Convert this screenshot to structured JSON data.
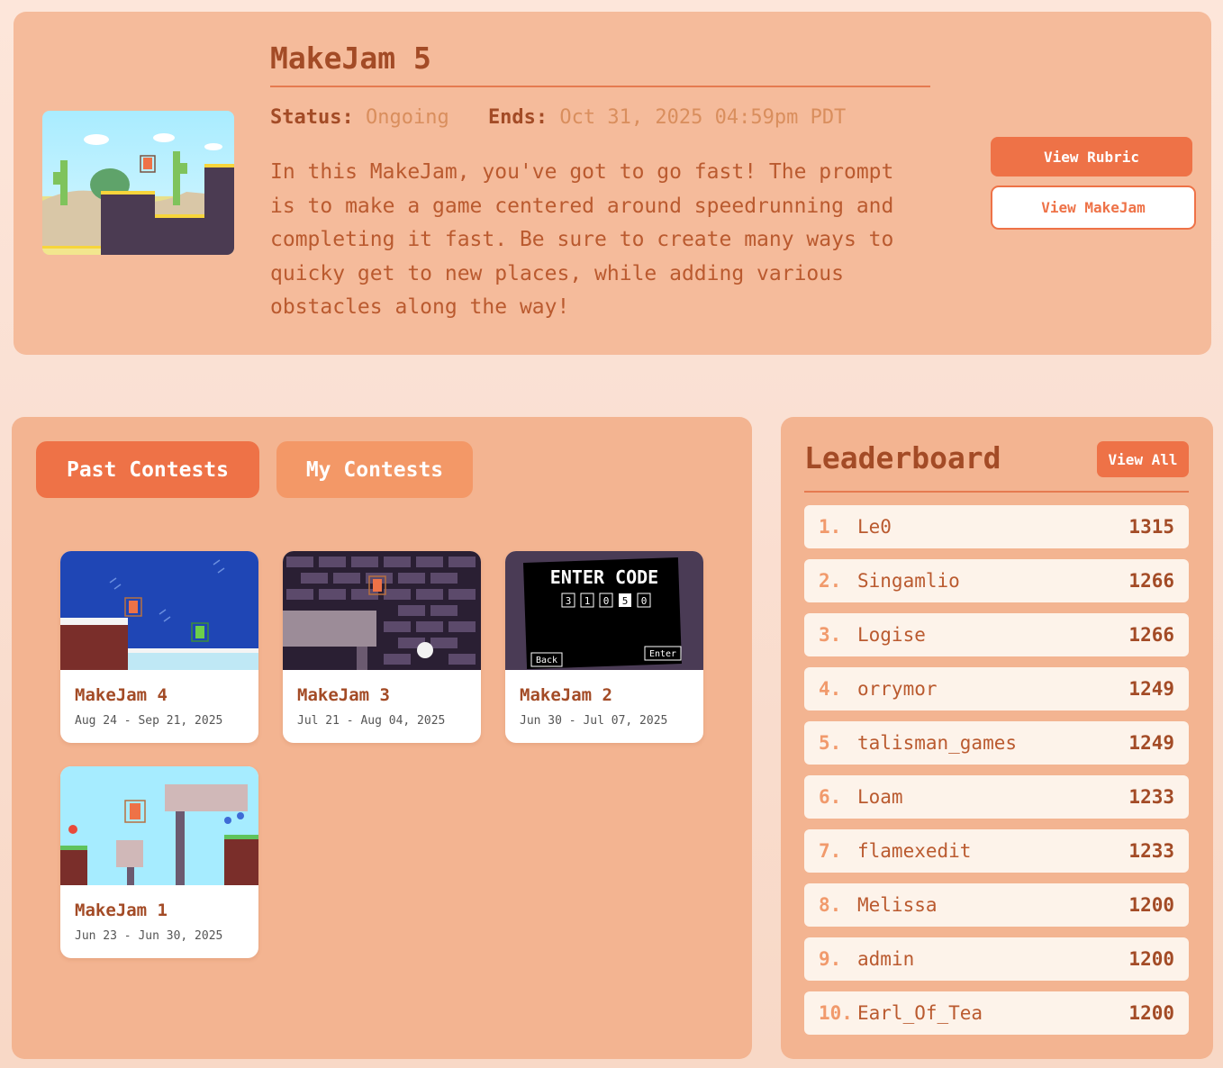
{
  "current": {
    "title": "MakeJam 5",
    "status_label": "Status:",
    "status_value": "Ongoing",
    "ends_label": "Ends:",
    "ends_value": "Oct 31, 2025 04:59pm PDT",
    "description": "In this MakeJam, you've got to go fast! The prompt is to make a game centered around speedrunning and completing it fast. Be sure to create many ways to quicky get to new places, while adding various obstacles along the way!",
    "view_rubric": "View Rubric",
    "view_makejam": "View MakeJam"
  },
  "tabs": {
    "past": "Past Contests",
    "mine": "My Contests"
  },
  "past_contests": [
    {
      "title": "MakeJam 4",
      "dates": "Aug 24 - Sep 21, 2025"
    },
    {
      "title": "MakeJam 3",
      "dates": "Jul 21 - Aug 04, 2025"
    },
    {
      "title": "MakeJam 2",
      "dates": "Jun 30 - Jul 07, 2025"
    },
    {
      "title": "MakeJam 1",
      "dates": "Jun 23 - Jun 30, 2025"
    }
  ],
  "thumb_text": {
    "enter_code": "ENTER CODE",
    "code_digits": [
      "3",
      "1",
      "0",
      "5",
      "0"
    ],
    "back": "Back",
    "enter": "Enter"
  },
  "leaderboard": {
    "title": "Leaderboard",
    "view_all": "View All",
    "entries": [
      {
        "rank": "1.",
        "name": "Le0",
        "score": "1315"
      },
      {
        "rank": "2.",
        "name": "Singamlio",
        "score": "1266"
      },
      {
        "rank": "3.",
        "name": "Logise",
        "score": "1266"
      },
      {
        "rank": "4.",
        "name": "orrymor",
        "score": "1249"
      },
      {
        "rank": "5.",
        "name": "talisman_games",
        "score": "1249"
      },
      {
        "rank": "6.",
        "name": "Loam",
        "score": "1233"
      },
      {
        "rank": "7.",
        "name": "flamexedit",
        "score": "1233"
      },
      {
        "rank": "8.",
        "name": "Melissa",
        "score": "1200"
      },
      {
        "rank": "9.",
        "name": "admin",
        "score": "1200"
      },
      {
        "rank": "10.",
        "name": "Earl_Of_Tea",
        "score": "1200"
      }
    ]
  },
  "colors": {
    "accent": "#ee7247",
    "panel": "#f3b491",
    "heading": "#a34b26",
    "text": "#ba5a2f"
  }
}
